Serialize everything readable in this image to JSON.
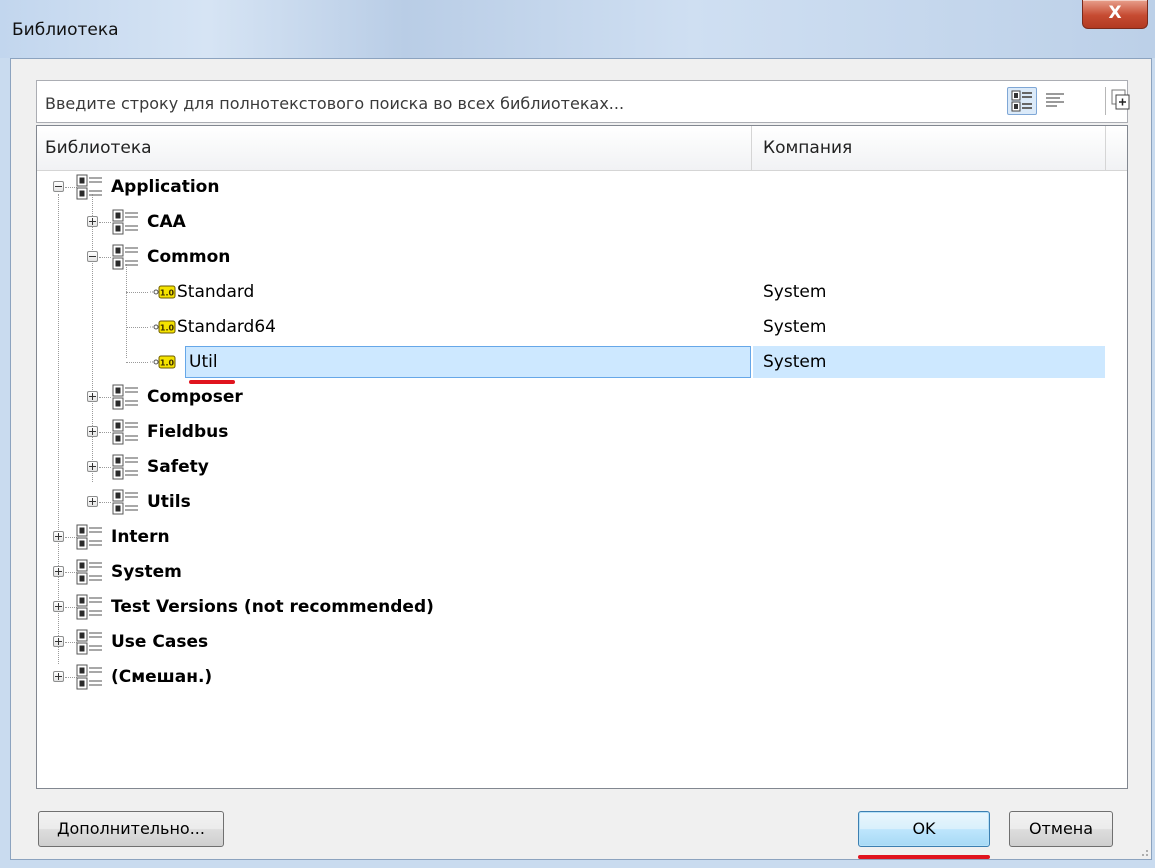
{
  "window": {
    "title": "Библиотека",
    "close_label": "X"
  },
  "search": {
    "placeholder": "Введите строку для полнотекстового поиска во всех библиотеках..."
  },
  "columns": {
    "library": "Библиотека",
    "company": "Компания"
  },
  "tree": {
    "application": "Application",
    "caa": "CAA",
    "common": "Common",
    "standard": "Standard",
    "standard_company": "System",
    "standard64": "Standard64",
    "standard64_company": "System",
    "util": "Util",
    "util_company": "System",
    "composer": "Composer",
    "fieldbus": "Fieldbus",
    "safety": "Safety",
    "utils": "Utils",
    "intern": "Intern",
    "system": "System",
    "test_versions": "Test Versions (not recommended)",
    "use_cases": "Use Cases",
    "mixed": "(Смешан.)"
  },
  "version_badge": "1.0",
  "buttons": {
    "advanced": "Дополнительно...",
    "ok": "OK",
    "cancel": "Отмена"
  },
  "colors": {
    "selection": "#cde8ff",
    "highlight_mark": "#e0141e"
  }
}
